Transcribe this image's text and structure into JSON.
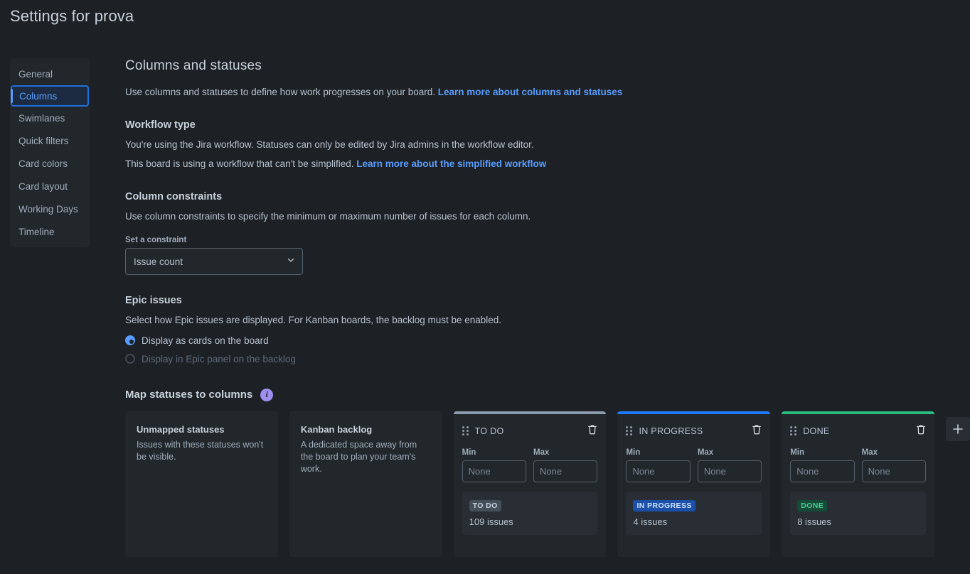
{
  "page": {
    "title": "Settings for prova"
  },
  "sidebar": {
    "items": [
      {
        "label": "General",
        "active": false
      },
      {
        "label": "Columns",
        "active": true
      },
      {
        "label": "Swimlanes",
        "active": false
      },
      {
        "label": "Quick filters",
        "active": false
      },
      {
        "label": "Card colors",
        "active": false
      },
      {
        "label": "Card layout",
        "active": false
      },
      {
        "label": "Working Days",
        "active": false
      },
      {
        "label": "Timeline",
        "active": false
      }
    ]
  },
  "main": {
    "heading": "Columns and statuses",
    "intro_text": "Use columns and statuses to define how work progresses on your board. ",
    "intro_link": "Learn more about columns and statuses",
    "workflow": {
      "heading": "Workflow type",
      "line1": "You're using the Jira workflow. Statuses can only be edited by Jira admins in the workflow editor.",
      "line2_text": "This board is using a workflow that can't be simplified. ",
      "line2_link": "Learn more about the simplified workflow"
    },
    "constraints": {
      "heading": "Column constraints",
      "description": "Use column constraints to specify the minimum or maximum number of issues for each column.",
      "field_label": "Set a constraint",
      "selected": "Issue count",
      "options": [
        "Issue count"
      ],
      "chevron_icon": "chevron-down-icon"
    },
    "epic": {
      "heading": "Epic issues",
      "description": "Select how Epic issues are displayed. For Kanban boards, the backlog must be enabled.",
      "options": [
        {
          "label": "Display as cards on the board",
          "selected": true,
          "disabled": false
        },
        {
          "label": "Display in Epic panel on the backlog",
          "selected": false,
          "disabled": true
        }
      ]
    },
    "map": {
      "heading": "Map statuses to columns",
      "info_icon": "info-icon",
      "info_glyph": "i",
      "static_columns": [
        {
          "title": "Unmapped statuses",
          "description": "Issues with these statuses won't be visible."
        },
        {
          "title": "Kanban backlog",
          "description": "A dedicated space away from the board to plan your team's work."
        }
      ],
      "columns": [
        {
          "title": "TO DO",
          "accent": "#8c9bab",
          "accent_name": "grey",
          "drag_icon": "drag-handle-icon",
          "delete_icon": "trash-icon",
          "min_label": "Min",
          "max_label": "Max",
          "min_value": "",
          "max_value": "",
          "min_placeholder": "None",
          "max_placeholder": "None",
          "statuses": [
            {
              "name": "TO DO",
              "count": "109 issues",
              "badge_style": "grey"
            }
          ]
        },
        {
          "title": "IN PROGRESS",
          "accent": "#1d7afc",
          "accent_name": "blue",
          "drag_icon": "drag-handle-icon",
          "delete_icon": "trash-icon",
          "min_label": "Min",
          "max_label": "Max",
          "min_value": "",
          "max_value": "",
          "min_placeholder": "None",
          "max_placeholder": "None",
          "statuses": [
            {
              "name": "IN PROGRESS",
              "count": "4 issues",
              "badge_style": "blue"
            }
          ]
        },
        {
          "title": "DONE",
          "accent": "#2abb7f",
          "accent_name": "green",
          "drag_icon": "drag-handle-icon",
          "delete_icon": "trash-icon",
          "min_label": "Min",
          "max_label": "Max",
          "min_value": "",
          "max_value": "",
          "min_placeholder": "None",
          "max_placeholder": "None",
          "statuses": [
            {
              "name": "DONE",
              "count": "8 issues",
              "badge_style": "green"
            }
          ]
        }
      ],
      "add_column_icon": "plus-icon"
    }
  },
  "colors": {
    "background": "#1d2125",
    "surface": "#22272b",
    "accent_link": "#579dff",
    "accent_selected": "#579dff",
    "info_purple": "#9f8fef",
    "status_grey": "#8c9bab",
    "status_blue": "#1d7afc",
    "status_green": "#2abb7f"
  }
}
